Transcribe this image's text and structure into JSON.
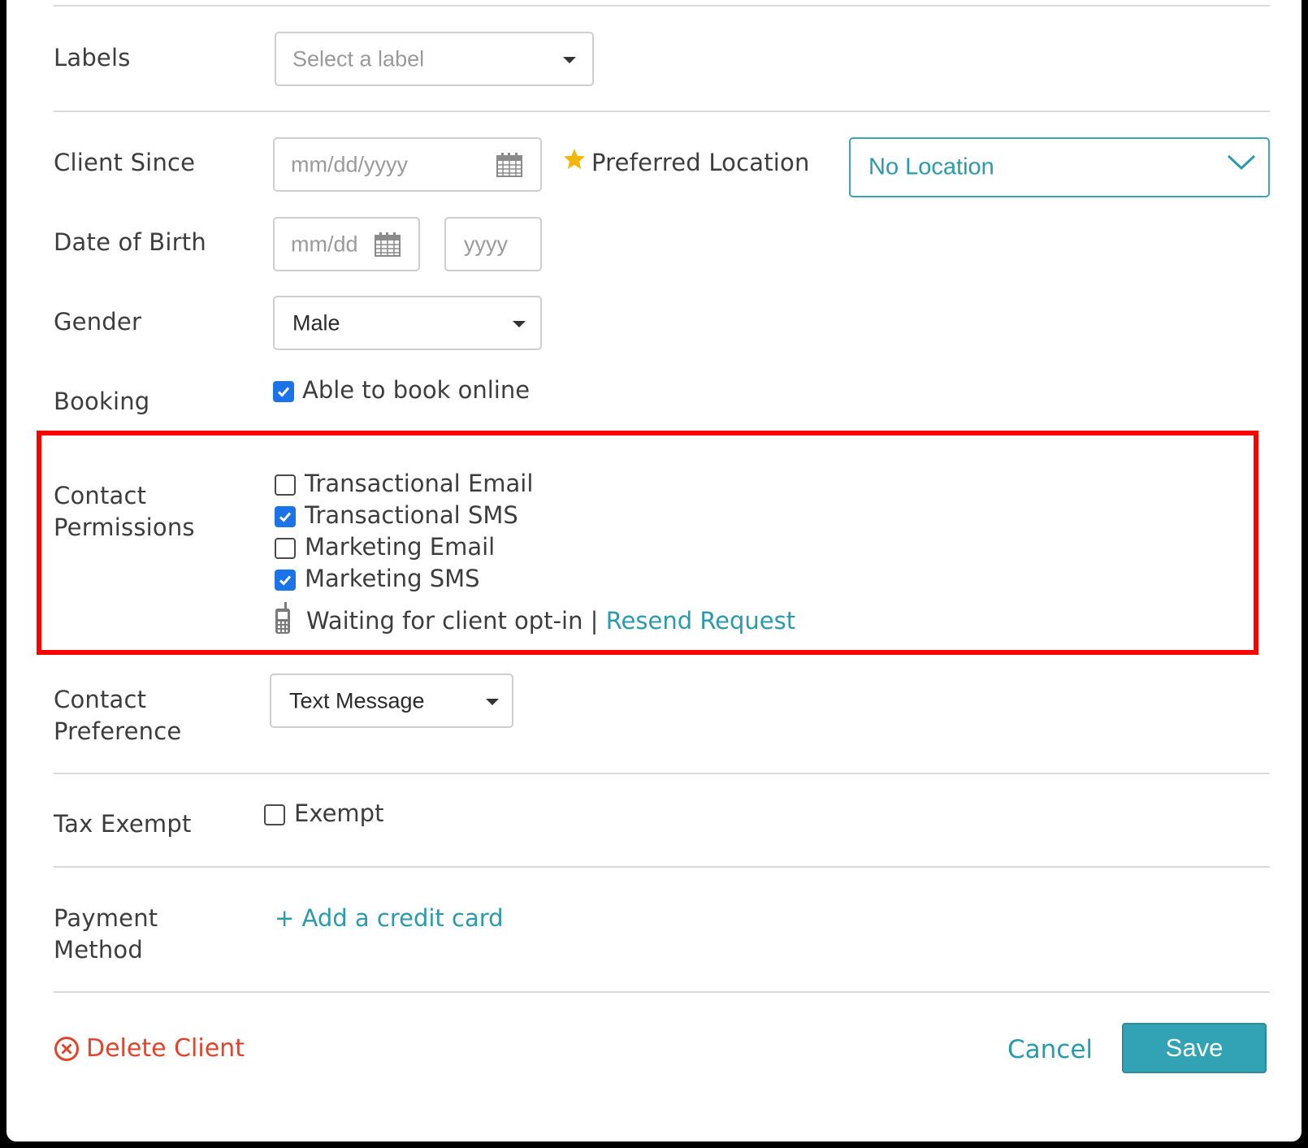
{
  "form": {
    "labels": {
      "label": "Labels",
      "placeholder": "Select a label"
    },
    "client_since": {
      "label": "Client Since",
      "placeholder": "mm/dd/yyyy"
    },
    "preferred_location": {
      "label": "Preferred Location",
      "value": "No Location"
    },
    "date_of_birth": {
      "label": "Date of Birth",
      "md_placeholder": "mm/dd",
      "year_placeholder": "yyyy"
    },
    "gender": {
      "label": "Gender",
      "value": "Male"
    },
    "booking": {
      "label": "Booking",
      "option_label": "Able to book online",
      "checked": true
    },
    "contact_permissions": {
      "label_line1": "Contact",
      "label_line2": "Permissions",
      "options": [
        {
          "label": "Transactional Email",
          "checked": false
        },
        {
          "label": "Transactional SMS",
          "checked": true
        },
        {
          "label": "Marketing Email",
          "checked": false
        },
        {
          "label": "Marketing SMS",
          "checked": true
        }
      ],
      "status_text": "Waiting for client opt-in |",
      "resend_link": "Resend Request"
    },
    "contact_preference": {
      "label_line1": "Contact",
      "label_line2": "Preference",
      "value": "Text Message"
    },
    "tax_exempt": {
      "label": "Tax Exempt",
      "option_label": "Exempt",
      "checked": false
    },
    "payment_method": {
      "label_line1": "Payment",
      "label_line2": "Method",
      "add_link": "+ Add a credit card"
    }
  },
  "footer": {
    "delete_label": "Delete Client",
    "cancel_label": "Cancel",
    "save_label": "Save"
  },
  "colors": {
    "accent": "#2a9aad",
    "danger": "#e0442b",
    "checkbox": "#1a73e8",
    "highlight": "#ff0000",
    "star": "#f2b705"
  }
}
